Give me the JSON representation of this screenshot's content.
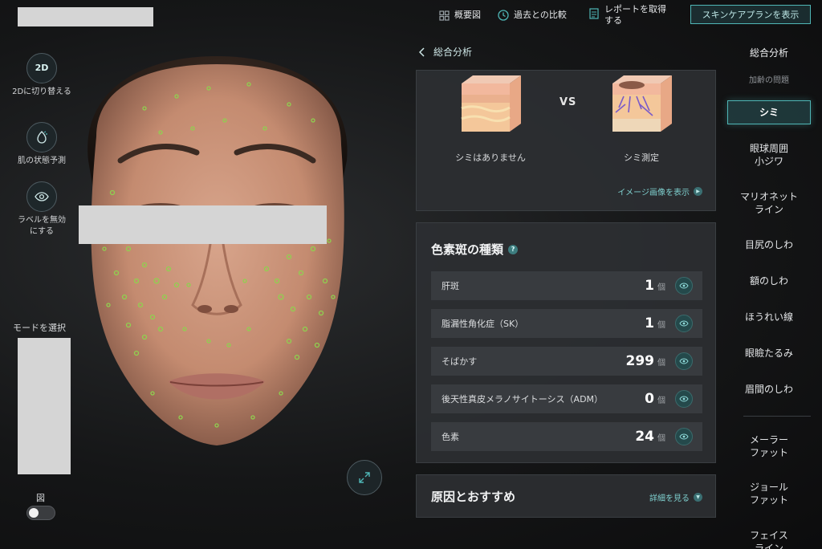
{
  "topbar": {
    "overview_label": "概要図",
    "compare_label": "過去との比較",
    "report_label": "レポートを取得する",
    "plan_button": "スキンケアプランを表示"
  },
  "left_tools": {
    "switch_2d_badge": "2D",
    "switch_2d_label": "2Dに切り替える",
    "predict_label": "肌の状態予測",
    "labels_off_label": "ラベルを無効にする"
  },
  "mode": {
    "label": "モードを選択"
  },
  "figure_toggle": {
    "label": "図",
    "on": false
  },
  "analysis": {
    "back_label": "総合分析",
    "compare": {
      "left_caption": "シミはありません",
      "vs": "VS",
      "right_caption": "シミ測定",
      "view_image": "イメージ画像を表示"
    },
    "pigment": {
      "title": "色素斑の種類",
      "unit": "個",
      "rows": [
        {
          "name": "肝斑",
          "count": "1"
        },
        {
          "name": "脂漏性角化症（SK）",
          "count": "1"
        },
        {
          "name": "そばかす",
          "count": "299"
        },
        {
          "name": "後天性真皮メラノサイトーシス（ADM）",
          "count": "0"
        },
        {
          "name": "色素",
          "count": "24"
        }
      ]
    },
    "cause": {
      "title": "原因とおすすめ",
      "details": "詳細を見る"
    }
  },
  "right_nav": {
    "header": "総合分析",
    "section": "加齢の問題",
    "items": [
      {
        "label": "シミ"
      },
      {
        "label": "眼球周囲\n小ジワ"
      },
      {
        "label": "マリオネット\nライン"
      },
      {
        "label": "目尻のしわ"
      },
      {
        "label": "額のしわ"
      },
      {
        "label": "ほうれい線"
      },
      {
        "label": "眼瞼たるみ"
      },
      {
        "label": "眉間のしわ"
      },
      {
        "label": "メーラー\nファット"
      },
      {
        "label": "ジョール\nファット"
      },
      {
        "label": "フェイス\nライン"
      }
    ]
  },
  "colors": {
    "accent": "#4fb6b6",
    "marker": "#8fd14f"
  }
}
